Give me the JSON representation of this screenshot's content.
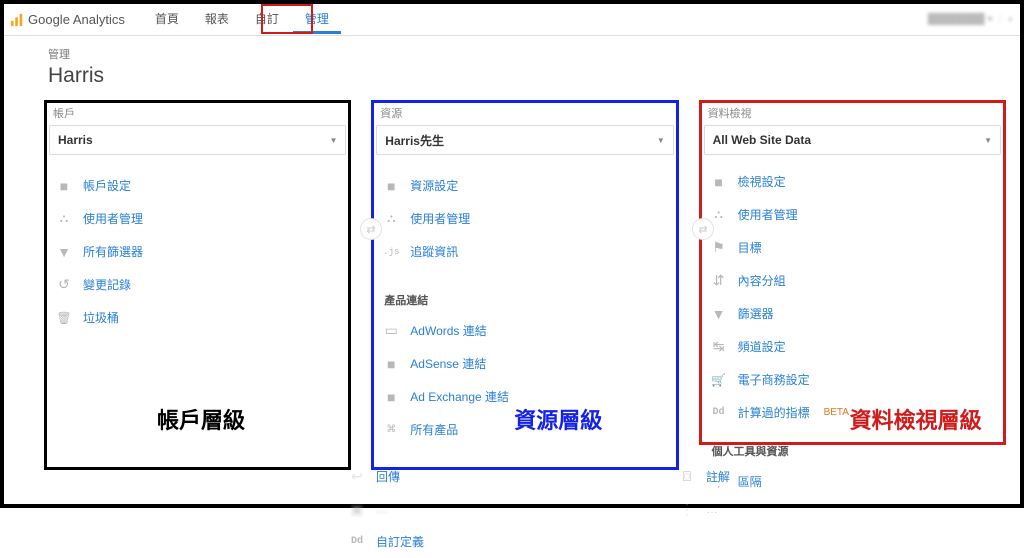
{
  "brand": "Google Analytics",
  "nav": [
    "首頁",
    "報表",
    "自訂",
    "管理"
  ],
  "nav_active_index": 3,
  "crumb": {
    "label": "管理",
    "title": "Harris"
  },
  "account": {
    "head": "帳戶",
    "selected": "Harris",
    "items": [
      {
        "icon": "i-doc",
        "label": "帳戶設定"
      },
      {
        "icon": "i-users",
        "label": "使用者管理"
      },
      {
        "icon": "i-funnel",
        "label": "所有篩選器"
      },
      {
        "icon": "i-history",
        "label": "變更記錄"
      },
      {
        "icon": "i-trash",
        "label": "垃圾桶"
      }
    ],
    "annotation": "帳戶層級"
  },
  "property": {
    "head": "資源",
    "selected": "Harris先生",
    "items": [
      {
        "icon": "i-doc",
        "label": "資源設定"
      },
      {
        "icon": "i-users",
        "label": "使用者管理"
      },
      {
        "icon": "i-js",
        "icon_text": ".js",
        "label": "追蹤資訊"
      }
    ],
    "section1": "產品連結",
    "linking": [
      {
        "icon": "i-card",
        "label": "AdWords 連結"
      },
      {
        "icon": "i-doc",
        "label": "AdSense 連結"
      },
      {
        "icon": "i-doc",
        "label": "Ad Exchange 連結"
      },
      {
        "icon": "i-link",
        "label": "所有產品"
      }
    ],
    "extra": [
      {
        "icon": "i-reply",
        "label": "回傳"
      },
      {
        "icon": "i-boxes",
        "label": "…"
      },
      {
        "icon": "i-dd",
        "icon_text": "Dd",
        "label": "自訂定義"
      }
    ],
    "annotation": "資源層級"
  },
  "view": {
    "head": "資料檢視",
    "selected": "All Web Site Data",
    "items": [
      {
        "icon": "i-doc",
        "label": "檢視設定"
      },
      {
        "icon": "i-users",
        "label": "使用者管理"
      },
      {
        "icon": "i-flag",
        "label": "目標"
      },
      {
        "icon": "i-branch",
        "label": "內容分組"
      },
      {
        "icon": "i-funnel",
        "label": "篩選器"
      },
      {
        "icon": "i-channel",
        "label": "頻道設定"
      },
      {
        "icon": "i-cart",
        "label": "電子商務設定"
      },
      {
        "icon": "i-dd",
        "icon_text": "Dd",
        "label": "計算過的指標",
        "beta": "BETA"
      }
    ],
    "section1": "個人工具與資源",
    "personal": [
      {
        "icon": "i-lines",
        "label": "區隔"
      },
      {
        "icon": "i-chat",
        "label": "註解"
      }
    ],
    "annotation": "資料檢視層級"
  }
}
